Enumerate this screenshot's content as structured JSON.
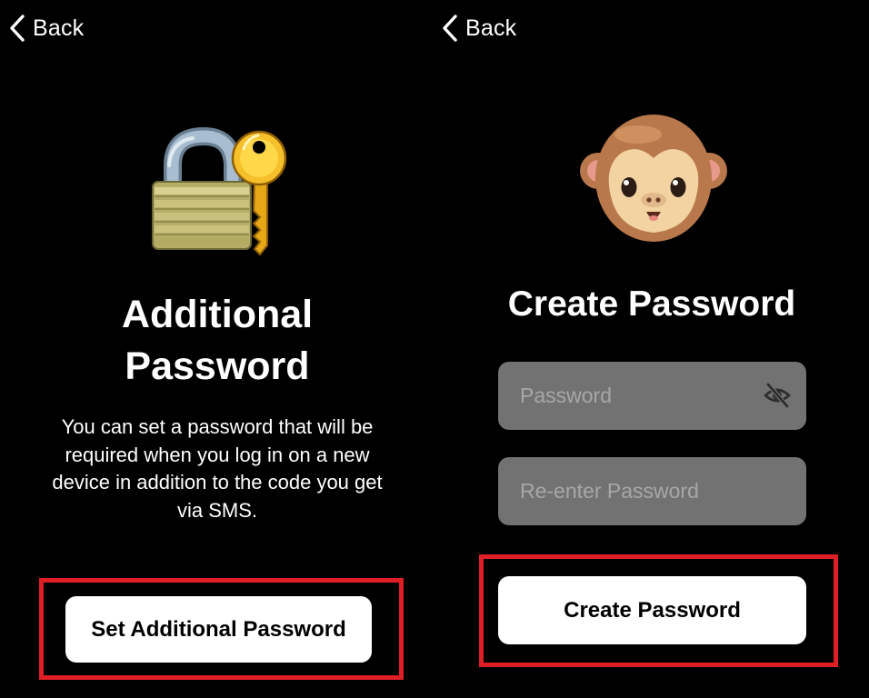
{
  "left_screen": {
    "back_label": "Back",
    "title_line_1": "Additional",
    "title_line_2": "Password",
    "description": "You can set a password that will be required when you log in on a new device in addition to the code you get via SMS.",
    "button_label": "Set Additional Password",
    "hero_icon": "lock-with-key-icon"
  },
  "right_screen": {
    "back_label": "Back",
    "title": "Create Password",
    "password_placeholder": "Password",
    "reenter_placeholder": "Re-enter Password",
    "button_label": "Create Password",
    "hero_icon": "monkey-face-icon"
  },
  "colors": {
    "background": "#000000",
    "highlight": "#e01e26",
    "field_background": "#727272",
    "button_background": "#ffffff"
  }
}
